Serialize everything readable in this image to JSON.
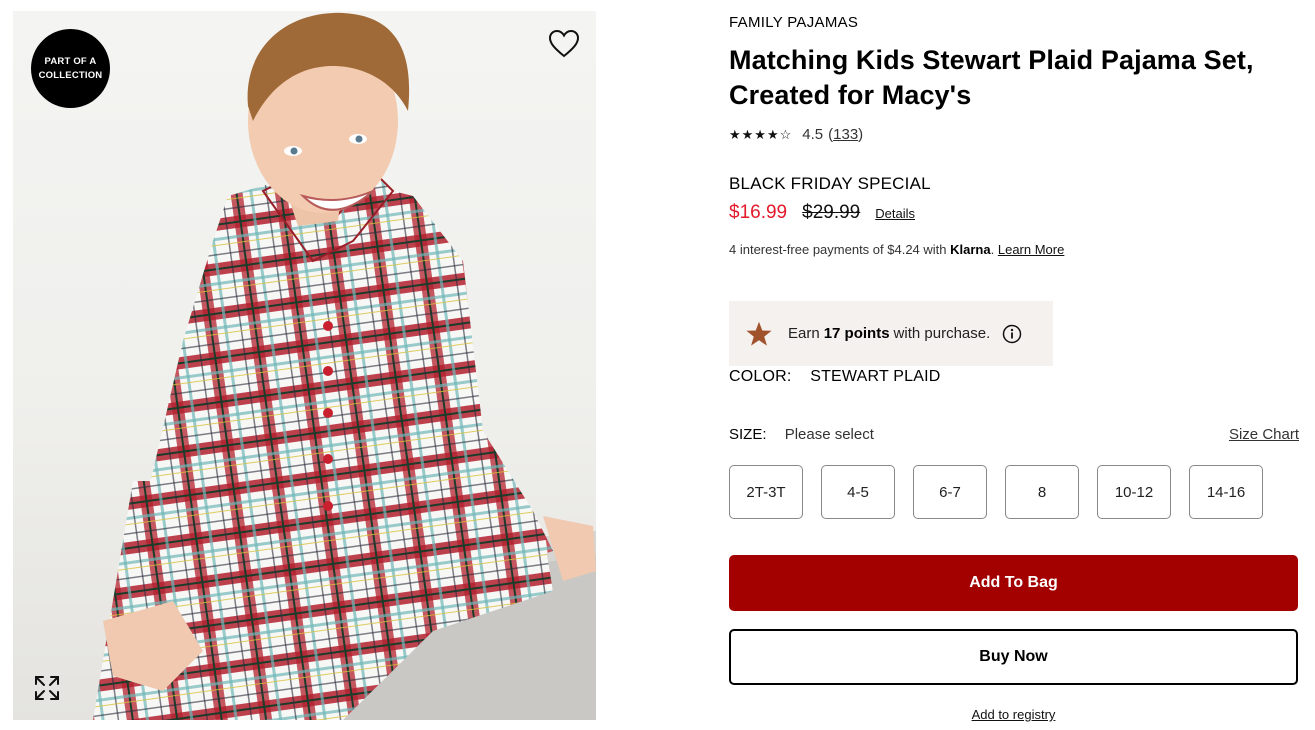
{
  "product_image": {
    "badge": "PART OF A COLLECTION",
    "wishlist_icon": "heart-outline-icon",
    "expand_icon": "expand-arrows-icon"
  },
  "product": {
    "brand": "FAMILY PAJAMAS",
    "title": "Matching Kids Stewart Plaid Pajama Set, Created for Macy's",
    "rating": {
      "stars_display": "★★★★☆",
      "value": "4.5",
      "count_open": "(",
      "count": "133",
      "count_close": ")"
    },
    "promo_label": "BLACK FRIDAY SPECIAL",
    "sale_price": "$16.99",
    "original_price": "$29.99",
    "details_link": "Details",
    "klarna": {
      "prefix": "4 interest-free payments of $4.24 with",
      "brand": "Klarna",
      "suffix": ".",
      "learn_more": "Learn More"
    },
    "points": {
      "pre": "Earn",
      "bold": "17 points",
      "post": "with purchase."
    },
    "color": {
      "label": "COLOR:",
      "value": "STEWART PLAID"
    },
    "size": {
      "label": "SIZE:",
      "value": "Please select",
      "chart_link": "Size Chart",
      "options": [
        "2T-3T",
        "4-5",
        "6-7",
        "8",
        "10-12",
        "14-16"
      ]
    },
    "add_to_bag": "Add To Bag",
    "buy_now": "Buy Now",
    "registry": "Add to registry"
  },
  "colors": {
    "sale_red": "#e21a2c",
    "bag_button": "#a30000",
    "points_bg": "#f5f1ef",
    "points_star": "#a0522d"
  }
}
